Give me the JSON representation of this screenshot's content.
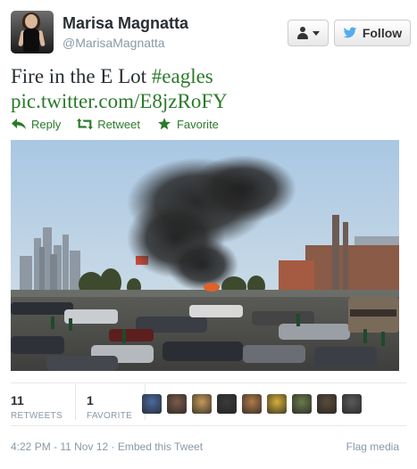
{
  "user": {
    "name": "Marisa Magnatta",
    "handle": "@MarisaMagnatta"
  },
  "buttons": {
    "follow_label": "Follow",
    "user_actions_icon": "person-caret-icon"
  },
  "tweet": {
    "text": "Fire in the E Lot",
    "hashtag": "#eagles",
    "link": "pic.twitter.com/E8jzRoFY"
  },
  "actions": [
    {
      "label": "Reply",
      "icon": "reply-icon"
    },
    {
      "label": "Retweet",
      "icon": "retweet-icon"
    },
    {
      "label": "Favorite",
      "icon": "star-icon"
    }
  ],
  "stats": {
    "retweets_count": "11",
    "retweets_label": "RETWEETS",
    "favorites_count": "1",
    "favorites_label": "FAVORITE"
  },
  "retweeter_colors": [
    "#4a6a9e",
    "#7a5a4a",
    "#c49a5a",
    "#3a3a3a",
    "#b07a4a",
    "#d4b03a",
    "#6a7a4a",
    "#5a4a3a",
    "#5a5a5a"
  ],
  "footer": {
    "timestamp": "4:22 PM - 11 Nov 12",
    "separator": "·",
    "embed": "Embed this Tweet",
    "flag": "Flag media"
  },
  "colors": {
    "accent_green": "#2b7a2b",
    "muted": "#8899a6"
  }
}
